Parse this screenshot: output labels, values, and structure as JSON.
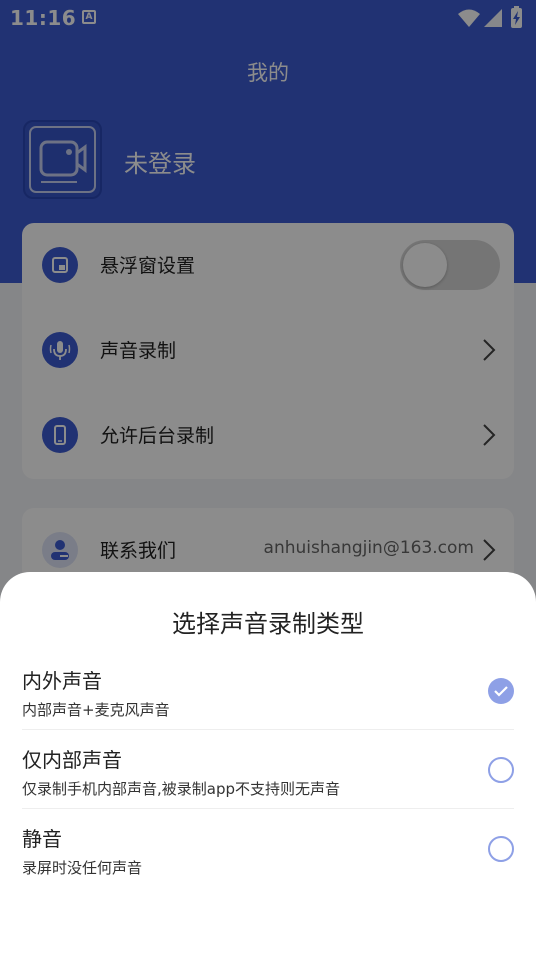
{
  "status_bar": {
    "time": "11:16",
    "notification_icon_letter": "A"
  },
  "header": {
    "title": "我的"
  },
  "profile": {
    "login_label": "未登录"
  },
  "settings_card": {
    "items": [
      {
        "label": "悬浮窗设置",
        "icon": "floating-window-icon",
        "control": "toggle",
        "toggle_on": false
      },
      {
        "label": "声音录制",
        "icon": "microphone-icon",
        "control": "chevron"
      },
      {
        "label": "允许后台录制",
        "icon": "phone-icon",
        "control": "chevron"
      }
    ]
  },
  "contact_card": {
    "label": "联系我们",
    "value": "anhuishangjin@163.com",
    "icon": "user-icon"
  },
  "sheet": {
    "title": "选择声音录制类型",
    "options": [
      {
        "title": "内外声音",
        "desc": "内部声音+麦克风声音",
        "selected": true
      },
      {
        "title": "仅内部声音",
        "desc": "仅录制手机内部声音,被录制app不支持则无声音",
        "selected": false
      },
      {
        "title": "静音",
        "desc": "录屏时没任何声音",
        "selected": false
      }
    ]
  },
  "colors": {
    "primary": "#3d5bd1",
    "radio_accent": "#8ea0e6",
    "background": "#f3f4f8"
  }
}
